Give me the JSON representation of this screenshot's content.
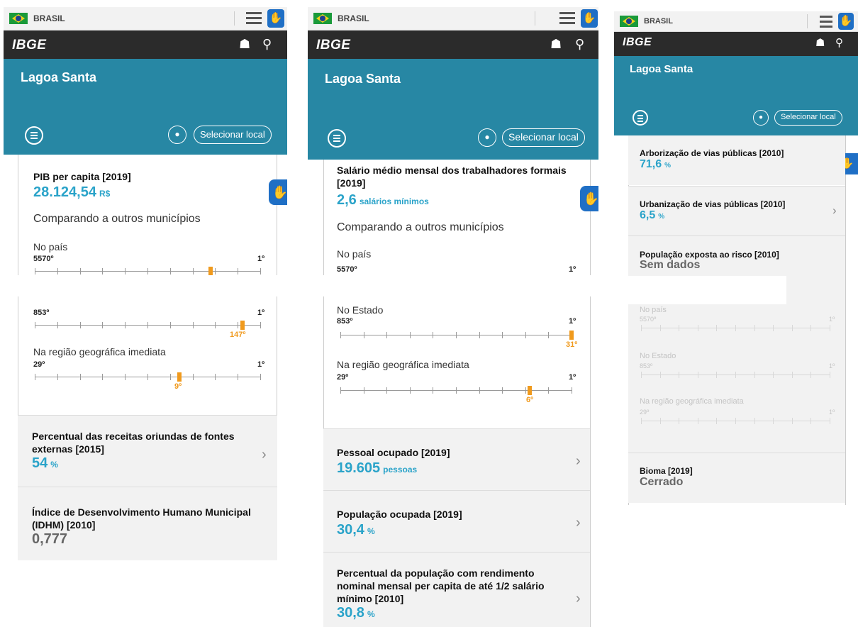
{
  "common": {
    "country": "BRASIL",
    "brand": "IBGE",
    "city": "Lagoa Santa",
    "select_local": "Selecionar local",
    "compare_heading": "Comparando a outros municípios",
    "no_pais": "No país",
    "no_estado": "No Estado",
    "na_regiao": "Na região geográfica imediata",
    "rank_first": "1º",
    "rank_pais_total": "5570º",
    "rank_estado_total": "853º",
    "rank_regiao_total": "29º"
  },
  "colors": {
    "hero": "#2787a4",
    "accent": "#2aa3c9",
    "marker": "#f09a1d",
    "dark_bar": "#2b2b2b"
  },
  "icons": [
    "flag-brazil-icon",
    "hamburger-icon",
    "vlibras-hand-icon",
    "ibge-building-icon",
    "search-icon",
    "location-pin-icon",
    "chevron-right-icon"
  ],
  "panel1": {
    "card1": {
      "title": "PIB per capita [2019]",
      "value": "28.124,54",
      "unit": "R$",
      "estado_marker": "147º",
      "regiao_marker": "9º",
      "pais_pos": 0.78,
      "estado_pos": 0.84,
      "regiao_pos": 0.71
    },
    "card2": {
      "title_line1": "Percentual das receitas oriundas de fontes",
      "title_line2": "externas [2015]",
      "value": "54",
      "unit": "%"
    },
    "card3": {
      "title_line1": "Índice de Desenvolvimento Humano Municipal",
      "title_line2": "(IDHM) [2010]",
      "value": "0,777"
    }
  },
  "panel2": {
    "card1": {
      "title_line1": "Salário médio mensal dos trabalhadores formais",
      "title_line2": "[2019]",
      "value": "2,6",
      "unit": "salários mínimos",
      "estado_marker": "31º",
      "regiao_marker": "6º"
    },
    "card2": {
      "title": "Pessoal ocupado [2019]",
      "value": "19.605",
      "unit": "pessoas"
    },
    "card3": {
      "title": "População ocupada [2019]",
      "value": "30,4",
      "unit": "%"
    },
    "card4": {
      "title_line1": "Percentual da população com rendimento",
      "title_line2": "nominal mensal per capita de até 1/2 salário",
      "title_line3": "mínimo [2010]",
      "value": "30,8",
      "unit": "%"
    }
  },
  "panel3": {
    "card1": {
      "title": "Arborização de vias públicas [2010]",
      "value": "71,6",
      "unit": "%"
    },
    "card2": {
      "title": "Urbanização de vias públicas [2010]",
      "value": "6,5",
      "unit": "%"
    },
    "card3": {
      "title": "População exposta ao risco [2010]",
      "value": "Sem dados"
    },
    "card4": {
      "title": "Bioma [2019]",
      "value": "Cerrado"
    }
  }
}
